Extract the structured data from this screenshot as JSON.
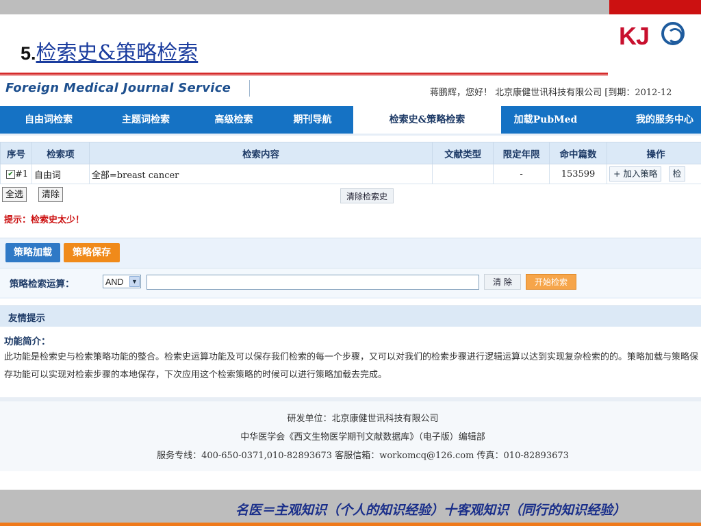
{
  "slide": {
    "number": "5.",
    "title": "检索史&策略检索",
    "logo": "KJ",
    "footer_quote": "名医＝主观知识（个人的知识经验）十客观知识（同行的知识经验）"
  },
  "app": {
    "logo": "Foreign Medical Journal Service",
    "user_info": "蒋鹏辉，您好！ 北京康健世讯科技有限公司 [到期：2012-12"
  },
  "nav": [
    {
      "label": "自由词检索"
    },
    {
      "label": "主题词检索"
    },
    {
      "label": "高级检索"
    },
    {
      "label": "期刊导航"
    },
    {
      "label": "检索史&策略检索",
      "active": true
    },
    {
      "label": "加载PubMed"
    },
    {
      "label": "我的服务中心"
    }
  ],
  "history": {
    "headers": [
      "序号",
      "检索项",
      "检索内容",
      "文献类型",
      "限定年限",
      "命中篇数",
      "操作"
    ],
    "rows": [
      {
        "checked": true,
        "no": "#1",
        "field": "自由词",
        "content": "全部=breast cancer",
        "doc_type": "",
        "years": "-",
        "hits": "153599",
        "add_label": "+ 加入策略",
        "search_label": "检"
      }
    ],
    "select_all": "全选",
    "clear": "清除",
    "clear_history": "清除检索史",
    "tip": "提示：检索史太少！"
  },
  "strategy": {
    "load": "策略加载",
    "save": "策略保存",
    "op_label": "策略检索运算：",
    "operator": "AND",
    "input_value": "",
    "clear": "清 除",
    "start": "开始检索"
  },
  "tips": {
    "title": "友情提示",
    "func_title": "功能简介：",
    "func_text": "此功能是检索史与检索策略功能的整合。检索史运算功能及可以保存我们检索的每一个步骤，又可以对我们的检索步骤进行逻辑运算以达到实现复杂检索的的。策略加载与策略保存功能可以实现对检索步骤的本地保存，下次应用这个检索策略的时候可以进行策略加载去完成。"
  },
  "footer": {
    "line1": "研发单位：北京康健世讯科技有限公司",
    "line2": "中华医学会《西文生物医学期刊文献数据库》（电子版）编辑部",
    "line3": "服务专线：400-650-0371,010-82893673 客服信箱：workomcq@126.com 传真：010-82893673"
  }
}
